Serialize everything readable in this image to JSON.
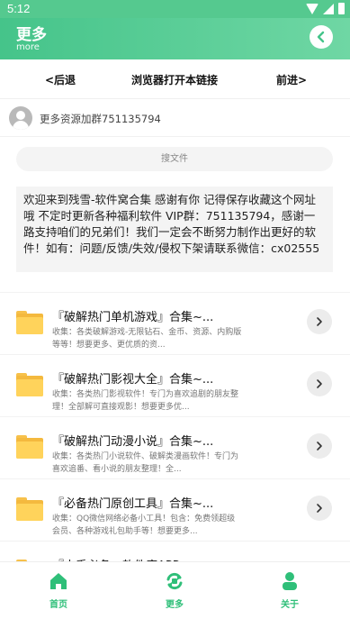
{
  "status_bar": {
    "time": "5:12"
  },
  "header": {
    "title": "更多",
    "subtitle": "more"
  },
  "nav": {
    "back": "<后退",
    "open_browser": "浏览器打开本链接",
    "forward": "前进>"
  },
  "group": {
    "text": "更多资源加群751135794"
  },
  "search": {
    "placeholder": "搜文件"
  },
  "notice": {
    "text": "欢迎来到残雪-软件窝合集 感谢有你 记得保存收藏这个网址哦 不定时更新各种福利软件 VIP群：751135794，感谢一路支持咱们的兄弟们！我们一定会不断努力制作出更好的软件！如有：问题/反馈/失效/侵权下架请联系微信：cx02555"
  },
  "items": [
    {
      "title": "『破解热门单机游戏』合集~...",
      "desc": "收集：各类破解游戏-无限钻石、金币、资源、内购版等等！想要更多、更优质的资..."
    },
    {
      "title": "『破解热门影视大全』合集~...",
      "desc": "收集：各类热门影视软件！专门为喜欢追剧的朋友整理！全部解可直接观影！想要更多优..."
    },
    {
      "title": "『破解热门动漫小说』合集~...",
      "desc": "收集：各类热门小说软件、破解类漫画软件！专门为喜欢追番、看小说的朋友整理！全..."
    },
    {
      "title": "『必备热门原创工具』合集~...",
      "desc": "收集：QQ微信网络必备小工具！包含：免费领超级会员、各种游戏礼包助手等！想要更多..."
    },
    {
      "title": "『人手必备』软件库APP...",
      "desc": ""
    }
  ],
  "tabbar": {
    "home": "首页",
    "more": "更多",
    "about": "关于"
  },
  "colors": {
    "accent": "#45c48a",
    "folder": "#ffd35b"
  },
  "icons": {
    "back": "chevron-left-icon",
    "item_arrow": "chevron-right-icon",
    "folder": "folder-icon",
    "home": "home-icon",
    "more": "refresh-icon",
    "about": "user-icon"
  }
}
